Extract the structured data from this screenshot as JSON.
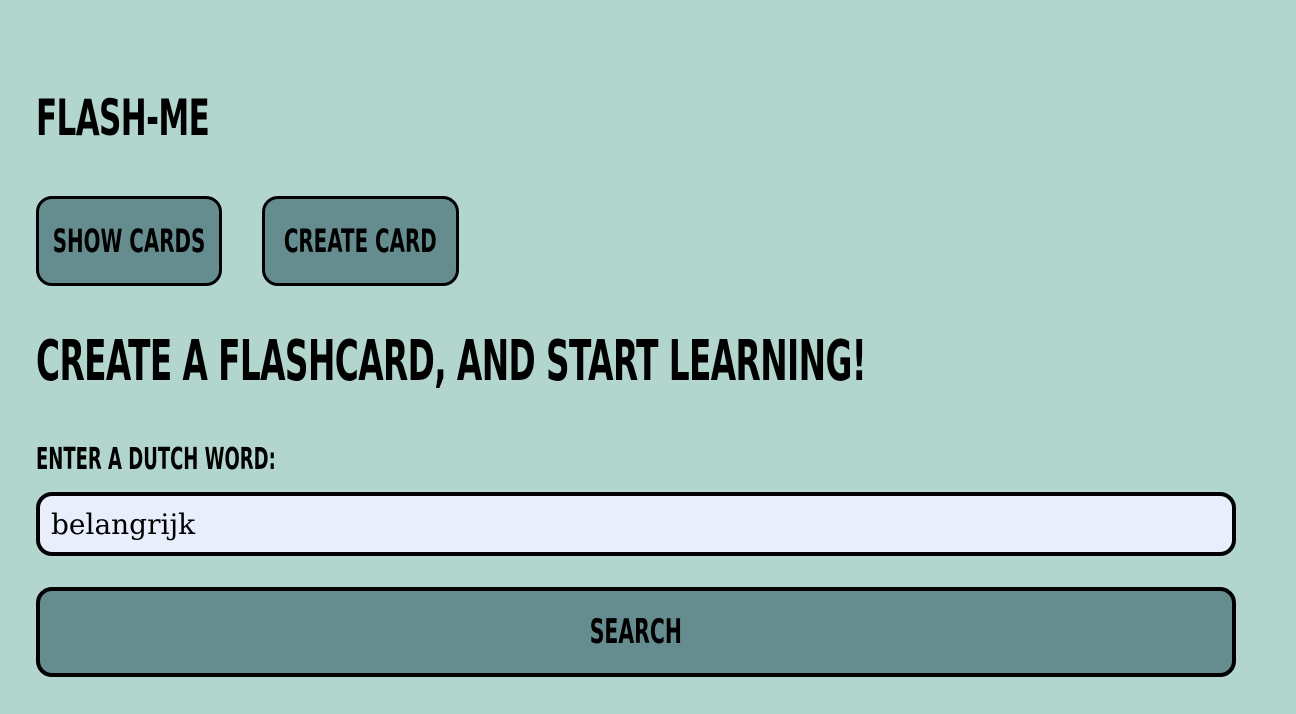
{
  "app": {
    "title": "FLASH-ME"
  },
  "nav": {
    "show_cards_label": "SHOW CARDS",
    "create_card_label": "CREATE CARD"
  },
  "main": {
    "headline": "CREATE A FLASHCARD, AND START LEARNING!",
    "input_label": "ENTER A DUTCH WORD:",
    "input_value": "belangrijk",
    "search_label": "SEARCH"
  },
  "colors": {
    "background": "#b2d5ce",
    "button": "#658d8f",
    "input_background": "#e8eefc",
    "border": "#000000"
  }
}
